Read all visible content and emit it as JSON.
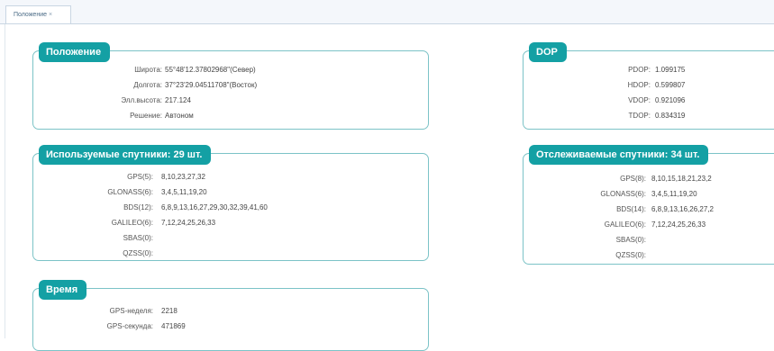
{
  "tab": {
    "label": "Положение",
    "close": "×"
  },
  "position": {
    "title": "Положение",
    "rows": [
      {
        "label": "Широта:",
        "value": "55°48'12.37802968\"(Север)"
      },
      {
        "label": "Долгота:",
        "value": "37°23'29.04511708\"(Восток)"
      },
      {
        "label": "Элл.высота:",
        "value": "217.124"
      },
      {
        "label": "Решение:",
        "value": "Автоном"
      }
    ]
  },
  "dop": {
    "title": "DOP",
    "rows": [
      {
        "label": "PDOP:",
        "value": "1.099175"
      },
      {
        "label": "HDOP:",
        "value": "0.599807"
      },
      {
        "label": "VDOP:",
        "value": "0.921096"
      },
      {
        "label": "TDOP:",
        "value": "0.834319"
      }
    ]
  },
  "used": {
    "title": "Используемые спутники: 29 шт.",
    "rows": [
      {
        "label": "GPS(5):",
        "value": "8,10,23,27,32"
      },
      {
        "label": "GLONASS(6):",
        "value": "3,4,5,11,19,20"
      },
      {
        "label": "BDS(12):",
        "value": "6,8,9,13,16,27,29,30,32,39,41,60"
      },
      {
        "label": "GALILEO(6):",
        "value": "7,12,24,25,26,33"
      },
      {
        "label": "SBAS(0):",
        "value": ""
      },
      {
        "label": "QZSS(0):",
        "value": ""
      }
    ]
  },
  "tracked": {
    "title": "Отслеживаемые спутники: 34 шт.",
    "rows": [
      {
        "label": "GPS(8):",
        "value": "8,10,15,18,21,23,2"
      },
      {
        "label": "GLONASS(6):",
        "value": "3,4,5,11,19,20"
      },
      {
        "label": "BDS(14):",
        "value": "6,8,9,13,16,26,27,2"
      },
      {
        "label": "GALILEO(6):",
        "value": "7,12,24,25,26,33"
      },
      {
        "label": "SBAS(0):",
        "value": ""
      },
      {
        "label": "QZSS(0):",
        "value": ""
      }
    ]
  },
  "time": {
    "title": "Время",
    "rows": [
      {
        "label": "GPS-неделя:",
        "value": "2218"
      },
      {
        "label": "GPS-секунда:",
        "value": "471869"
      }
    ]
  }
}
